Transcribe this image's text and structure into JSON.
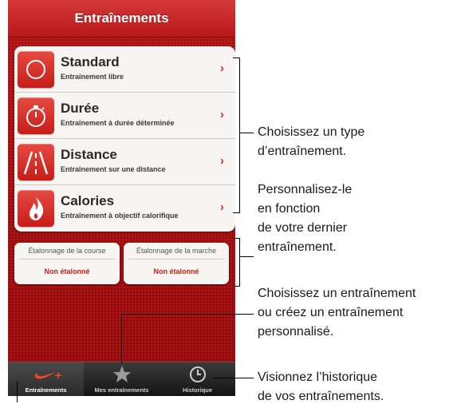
{
  "header": {
    "title": "Entraînements"
  },
  "workouts": [
    {
      "title": "Standard",
      "subtitle": "Entraînement libre",
      "icon": "circle-icon"
    },
    {
      "title": "Durée",
      "subtitle": "Entraînement à durée déterminée",
      "icon": "stopwatch-icon"
    },
    {
      "title": "Distance",
      "subtitle": "Entraînement sur une distance",
      "icon": "road-icon"
    },
    {
      "title": "Calories",
      "subtitle": "Entraînement à objectif calorifique",
      "icon": "flame-icon"
    }
  ],
  "chevron": "›",
  "calibration": {
    "run": {
      "title": "Étalonnage de la course",
      "status": "Non étalonné"
    },
    "walk": {
      "title": "Étalonnage de la marche",
      "status": "Non étalonné"
    }
  },
  "tabs": [
    {
      "label": "Entraînements",
      "icon": "nike-swoosh-plus-icon",
      "active": true
    },
    {
      "label": "Mes entraînements",
      "icon": "star-icon",
      "active": false
    },
    {
      "label": "Historique",
      "icon": "clock-icon",
      "active": false
    }
  ],
  "callouts": {
    "choose_type": [
      "Choisissez un type",
      "d’entraînement."
    ],
    "personalize": [
      "Personnalisez-le",
      "en fonction",
      "de votre dernier",
      "entraînement."
    ],
    "custom": [
      "Choisissez un entraînement",
      "ou créez un entraînement",
      "personnalisé."
    ],
    "history": [
      "Visionnez l’historique",
      "de vos entraînements."
    ]
  },
  "colors": {
    "accent": "#c0191a",
    "status": "#c2221d"
  }
}
